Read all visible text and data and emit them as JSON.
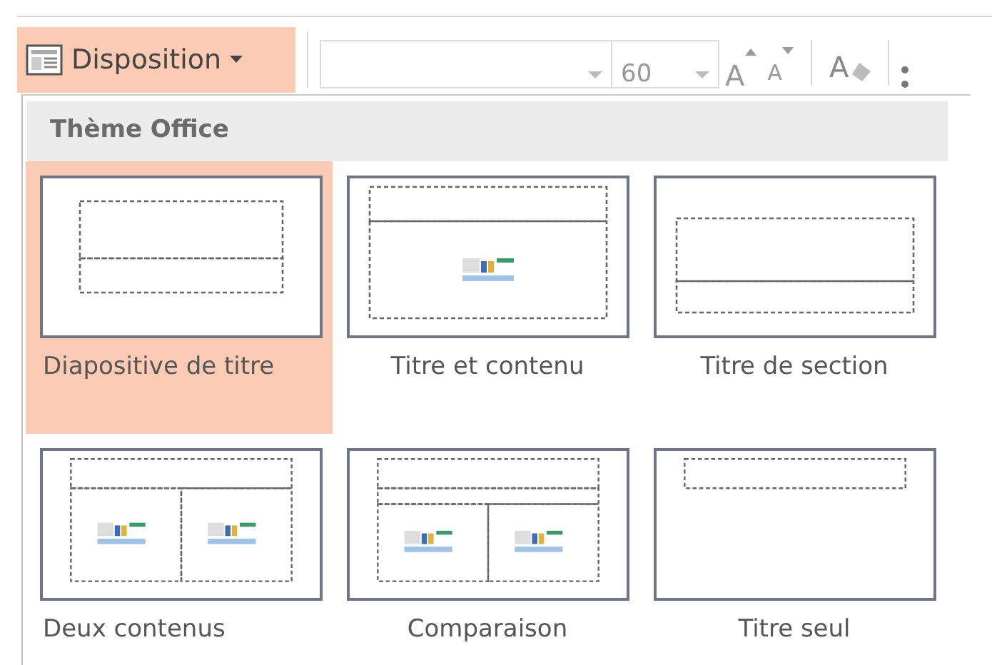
{
  "toolbar": {
    "layout_button": {
      "label": "Disposition",
      "active": true
    },
    "font_size": "60",
    "grow_font": "A",
    "shrink_font": "A",
    "clear_format": "A"
  },
  "gallery": {
    "header": "Thème Office",
    "layouts": [
      {
        "kind": "title",
        "label": "Diapositive de titre",
        "selected": true
      },
      {
        "kind": "title-content",
        "label": "Titre et contenu",
        "selected": false
      },
      {
        "kind": "section",
        "label": "Titre de section",
        "selected": false
      },
      {
        "kind": "two-content",
        "label": "Deux contenus",
        "selected": false
      },
      {
        "kind": "comparison",
        "label": "Comparaison",
        "selected": false
      },
      {
        "kind": "title-only",
        "label": "Titre seul",
        "selected": false
      }
    ]
  }
}
